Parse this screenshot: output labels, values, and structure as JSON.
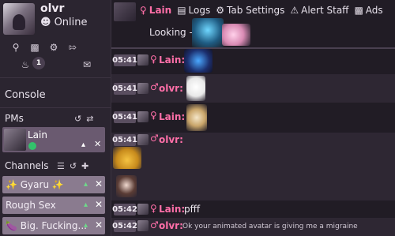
{
  "profile": {
    "username": "olvr",
    "status": "Online"
  },
  "sidebar": {
    "notification_count": "1",
    "console_label": "Console",
    "pms_label": "PMs",
    "channels_label": "Channels",
    "pms": [
      {
        "name": "Lain"
      }
    ],
    "channels": [
      {
        "name": "✨ Gyaru ✨"
      },
      {
        "name": "Rough Sex"
      },
      {
        "name": "🍆 Big. Fucking..."
      }
    ]
  },
  "topbar": {
    "tabs": [
      "Lain",
      "Logs",
      "Tab Settings",
      "Alert Staff",
      "Ads"
    ]
  },
  "chat": {
    "looking_text": "Looking -",
    "messages": [
      {
        "time": "05:41",
        "user": "Lain",
        "text": ""
      },
      {
        "time": "05:41",
        "user": "olvr",
        "text": ""
      },
      {
        "time": "05:41",
        "user": "Lain",
        "text": ""
      },
      {
        "time": "05:41",
        "user": "olvr",
        "text": ""
      },
      {
        "time": "05:42",
        "user": "Lain",
        "text": "pfff"
      },
      {
        "time": "05:42",
        "user": "olvr",
        "text": "Ok your animated avatar is giving me a migraine"
      }
    ]
  },
  "colors": {
    "accent_pink": "#ff6fa8",
    "online_green": "#33c26b",
    "pin_green": "#6ed98a"
  }
}
